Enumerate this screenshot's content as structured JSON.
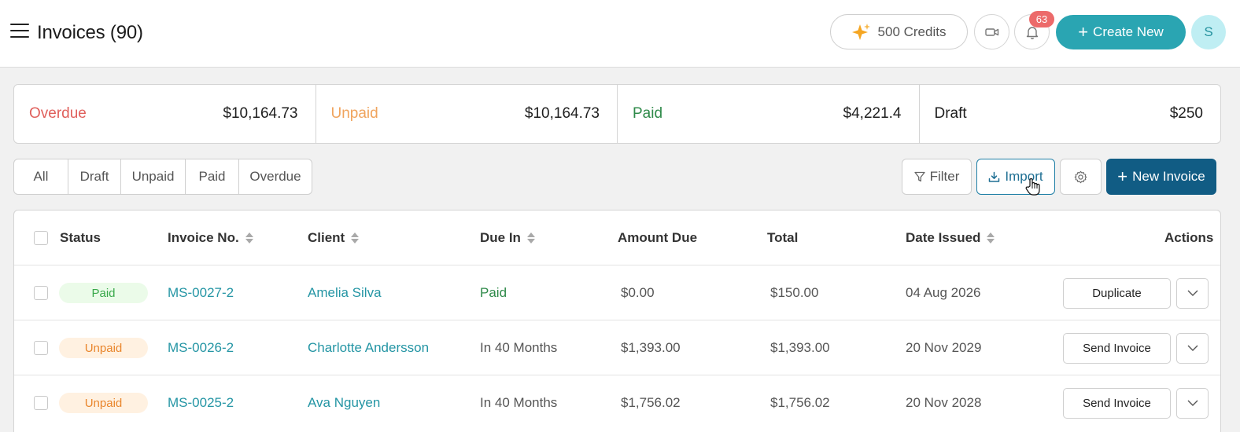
{
  "header": {
    "title": "Invoices (90)",
    "credits_label": "500 Credits",
    "notification_count": "63",
    "create_label": "Create New",
    "avatar_initial": "S"
  },
  "summary": [
    {
      "label": "Overdue",
      "value": "$10,164.73",
      "color": "#e0605c"
    },
    {
      "label": "Unpaid",
      "value": "$10,164.73",
      "color": "#f0a45d"
    },
    {
      "label": "Paid",
      "value": "$4,221.4",
      "color": "#2f8a4a"
    },
    {
      "label": "Draft",
      "value": "$250",
      "color": "#1e1e1e"
    }
  ],
  "tabs": [
    "All",
    "Draft",
    "Unpaid",
    "Paid",
    "Overdue"
  ],
  "toolbar": {
    "filter_label": "Filter",
    "import_label": "Import",
    "new_invoice_label": "New Invoice"
  },
  "table": {
    "columns": {
      "status": "Status",
      "invoice_no": "Invoice No.",
      "client": "Client",
      "due_in": "Due In",
      "amount_due": "Amount Due",
      "total": "Total",
      "date_issued": "Date Issued",
      "actions": "Actions"
    },
    "rows": [
      {
        "status": "Paid",
        "invoice_no": "MS-0027-2",
        "client": "Amelia Silva",
        "due_in": "Paid",
        "amount_due": "$0.00",
        "total": "$150.00",
        "date_issued": "04 Aug 2026",
        "action": "Duplicate"
      },
      {
        "status": "Unpaid",
        "invoice_no": "MS-0026-2",
        "client": "Charlotte Andersson",
        "due_in": "In 40 Months",
        "amount_due": "$1,393.00",
        "total": "$1,393.00",
        "date_issued": "20 Nov 2029",
        "action": "Send Invoice"
      },
      {
        "status": "Unpaid",
        "invoice_no": "MS-0025-2",
        "client": "Ava Nguyen",
        "due_in": "In 40 Months",
        "amount_due": "$1,756.02",
        "total": "$1,756.02",
        "date_issued": "20 Nov 2028",
        "action": "Send Invoice"
      }
    ]
  },
  "colors": {
    "accent": "#2aa5b2",
    "primary": "#115c84",
    "badge": "#ec6a6a"
  }
}
